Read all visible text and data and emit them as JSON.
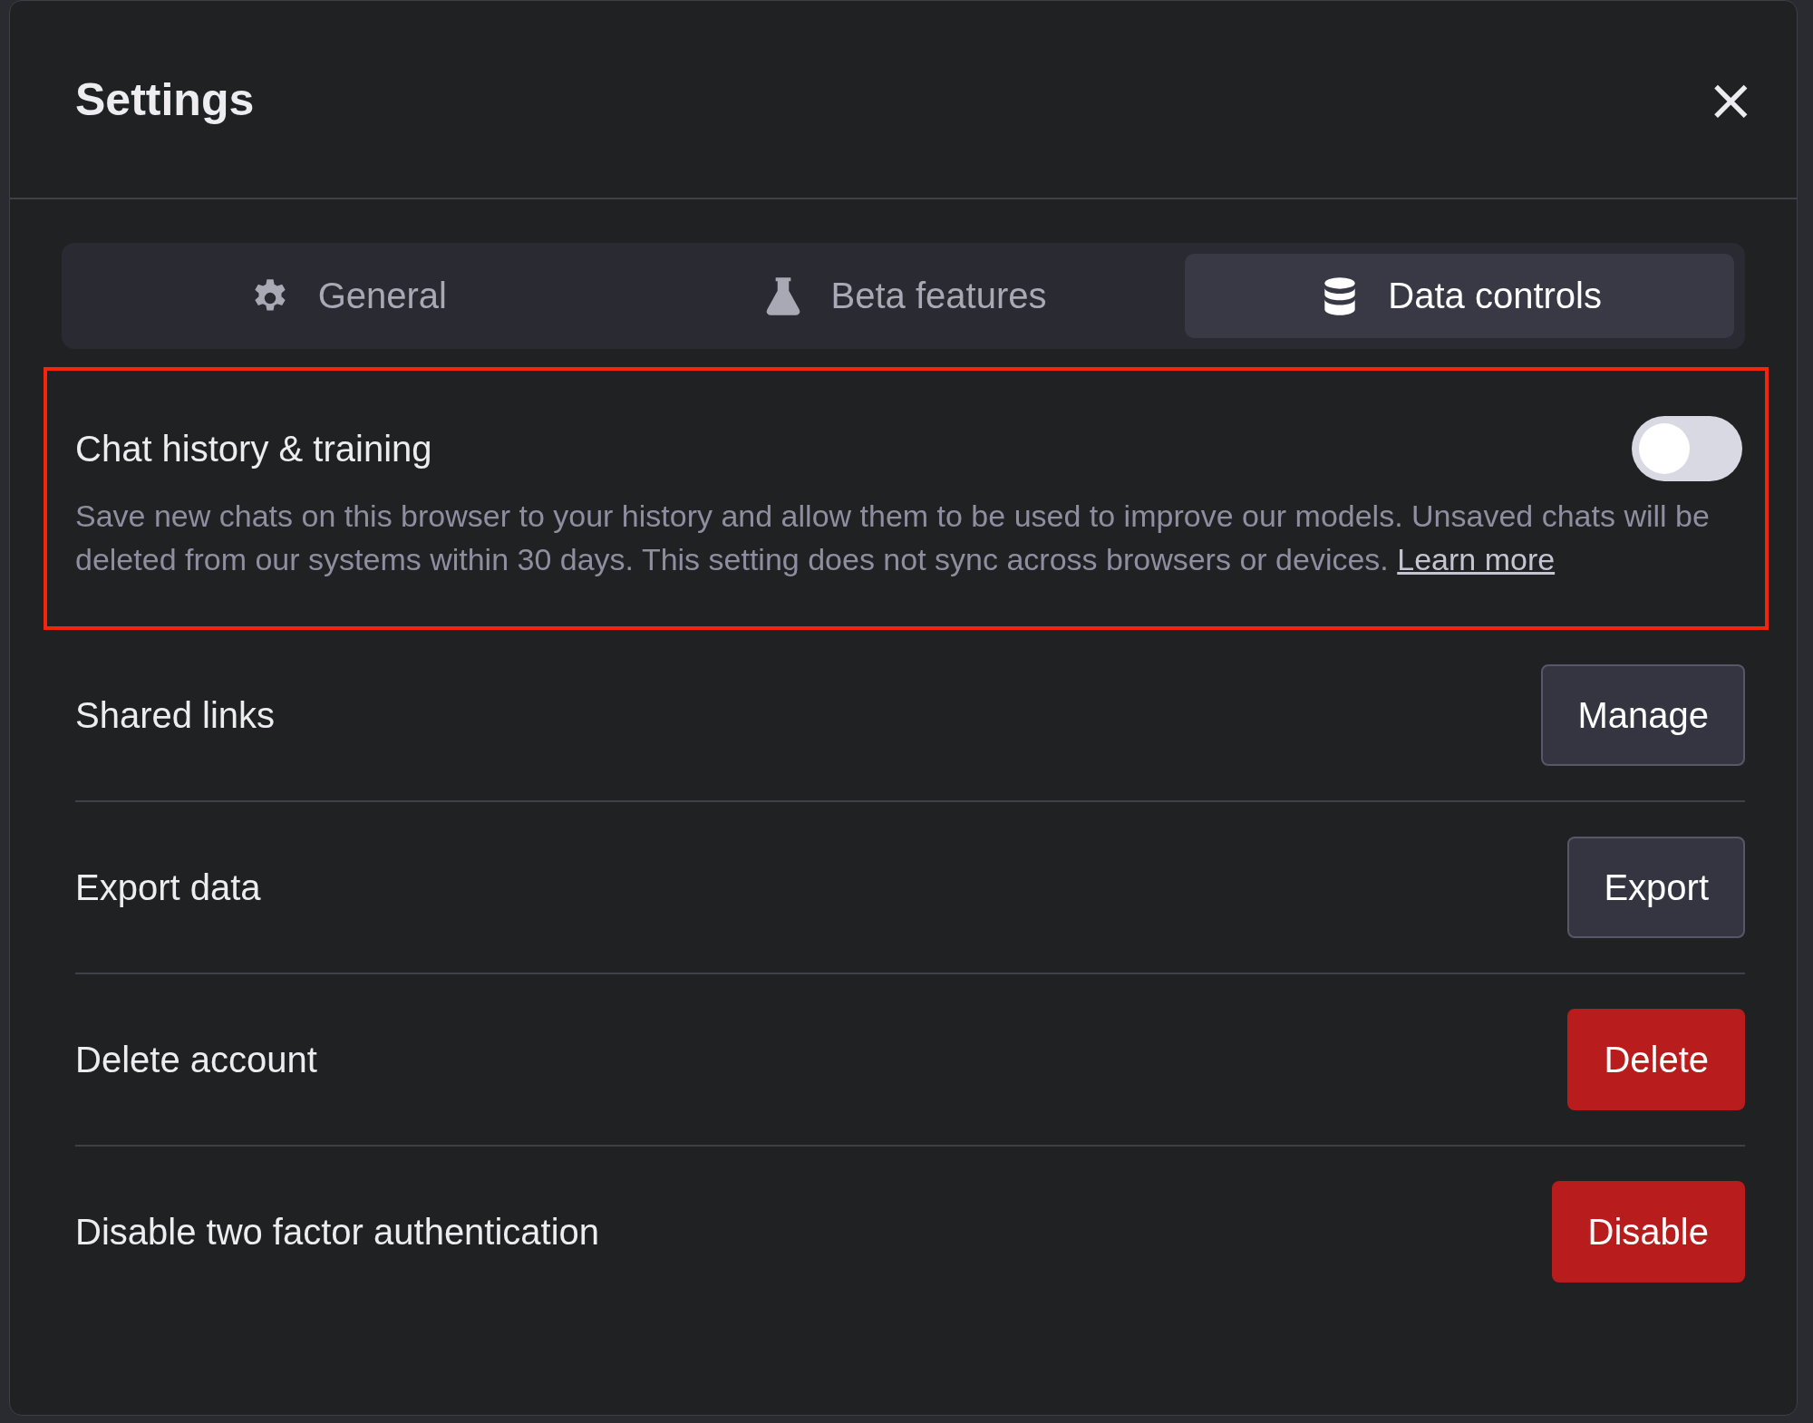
{
  "dialog": {
    "title": "Settings",
    "close_label": "×"
  },
  "tabs": [
    {
      "label": "General",
      "kind": "gear",
      "selected": false
    },
    {
      "label": "Beta features",
      "kind": "flask",
      "selected": false
    },
    {
      "label": "Data controls",
      "kind": "database",
      "selected": true
    }
  ],
  "chat_history": {
    "label": "Chat history & training",
    "on": false,
    "description": "Save new chats on this browser to your history and allow them to be used to improve our models. Unsaved chats will be deleted from our systems within 30 days. This setting does not sync across browsers or devices.",
    "link": "Learn more"
  },
  "rows": [
    {
      "label": "Shared links",
      "button": "Manage",
      "kind": "default"
    },
    {
      "label": "Export data",
      "button": "Export",
      "kind": "default"
    },
    {
      "label": "Delete account",
      "button": "Delete",
      "kind": "danger"
    },
    {
      "label": "Disable two factor authentication",
      "button": "Disable",
      "kind": "danger"
    }
  ]
}
